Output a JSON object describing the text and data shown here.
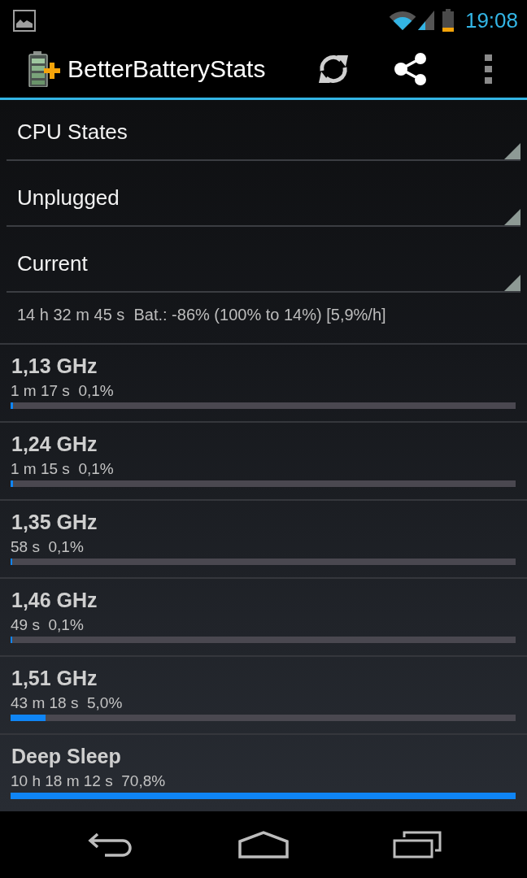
{
  "status_bar": {
    "time": "19:08"
  },
  "action_bar": {
    "title": "BetterBatteryStats"
  },
  "filters": [
    {
      "value": "CPU States"
    },
    {
      "value": "Unplugged"
    },
    {
      "value": "Current"
    }
  ],
  "summary": "14 h 32 m 45 s  Bat.: -86% (100% to 14%) [5,9%/h]",
  "states": [
    {
      "name": "1,13 GHz",
      "reading": "1 m 17 s  0,1%",
      "level": 0.005
    },
    {
      "name": "1,24 GHz",
      "reading": "1 m 15 s  0,1%",
      "level": 0.005
    },
    {
      "name": "1,35 GHz",
      "reading": "58 s  0,1%",
      "level": 0.004
    },
    {
      "name": "1,46 GHz",
      "reading": "49 s  0,1%",
      "level": 0.003
    },
    {
      "name": "1,51 GHz",
      "reading": "43 m 18 s  5,0%",
      "level": 0.07
    },
    {
      "name": "Deep Sleep",
      "reading": "10 h 18 m 12 s  70,8%",
      "level": 1
    }
  ]
}
